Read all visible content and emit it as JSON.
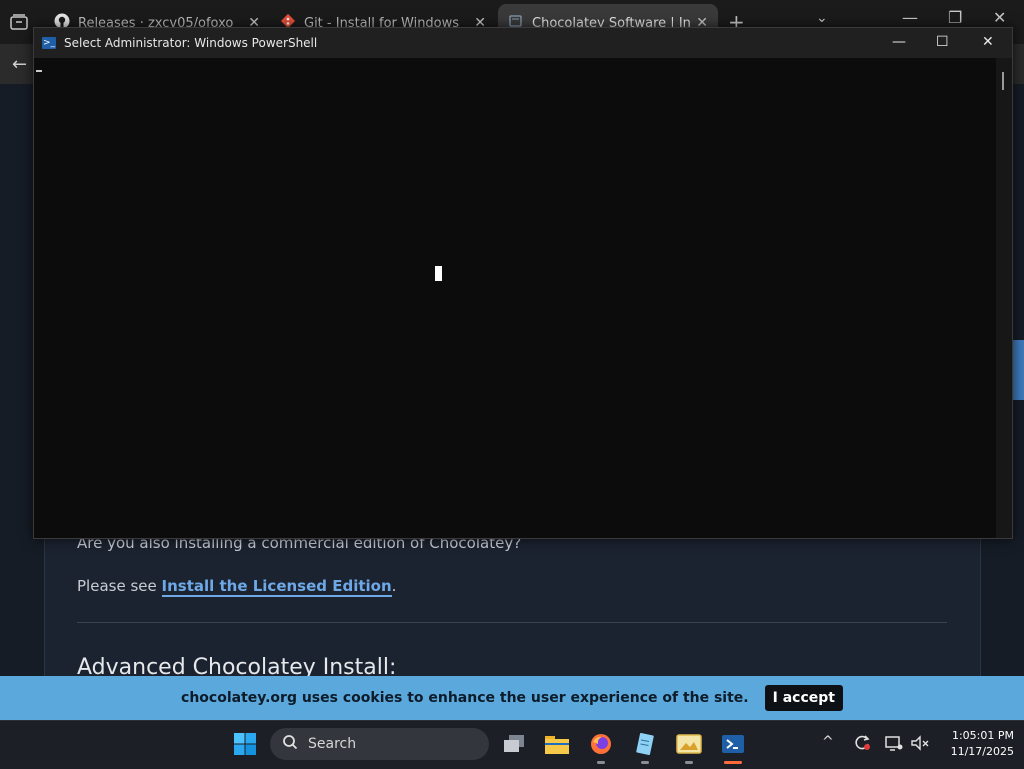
{
  "browser": {
    "tabs": [
      {
        "label": "Releases · zxcv05/ofoxo",
        "icon": "github-icon"
      },
      {
        "label": "Git - Install for Windows",
        "icon": "git-icon"
      },
      {
        "label": "Chocolatey Software | Installing",
        "icon": "chocolatey-icon"
      }
    ],
    "page": {
      "question": "Are you also installing a commercial edition of Chocolatey?",
      "see_prefix": "Please see ",
      "see_link": "Install the Licensed Edition",
      "see_suffix": ".",
      "heading": "Advanced Chocolatey Install:"
    },
    "cookie": {
      "message": "chocolatey.org uses cookies to enhance the user experience of the site.",
      "accept_label": "I accept"
    }
  },
  "powershell": {
    "title": "Select Administrator: Windows PowerShell"
  },
  "taskbar": {
    "search_label": "Search",
    "time": "1:05:01 PM",
    "date": "11/17/2025"
  },
  "colors": {
    "cookie_bar": "#5aa8dc",
    "link": "#6ea8e6",
    "console_bg": "#0c0c0c"
  }
}
